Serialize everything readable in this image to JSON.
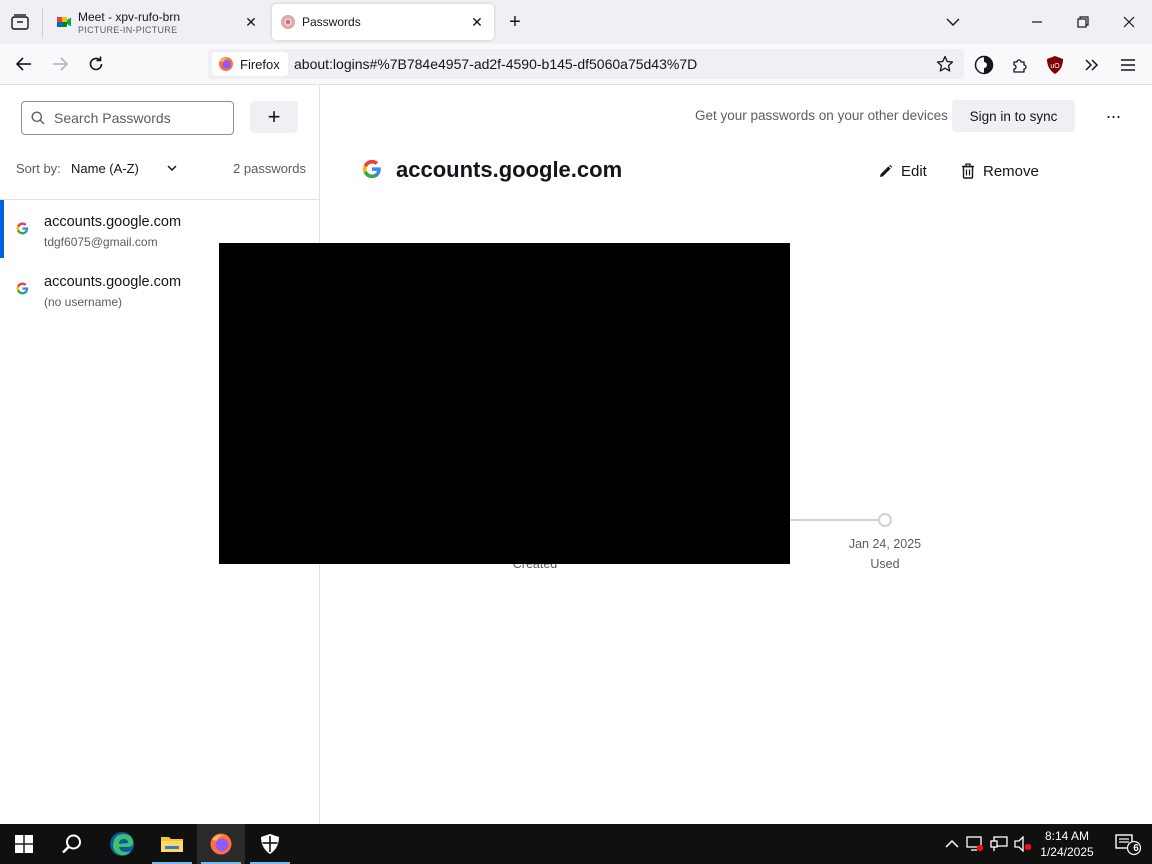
{
  "browser": {
    "tabs": [
      {
        "title": "Meet - xpv-rufo-brn",
        "subtitle": "PICTURE-IN-PICTURE",
        "icon": "google-meet-icon",
        "active": false
      },
      {
        "title": "Passwords",
        "icon": "passwords-icon",
        "active": true
      }
    ],
    "identity_label": "Firefox",
    "url": "about:logins#%7B784e4957-ad2f-4590-b145-df5060a75d43%7D"
  },
  "sidebar": {
    "search_placeholder": "Search Passwords",
    "add_label": "+",
    "sort_label": "Sort by:",
    "sort_value": "Name (A-Z)",
    "count": "2 passwords",
    "items": [
      {
        "host": "accounts.google.com",
        "user": "tdgf6075@gmail.com",
        "selected": true
      },
      {
        "host": "accounts.google.com",
        "user": "(no username)",
        "selected": false
      }
    ]
  },
  "detail": {
    "sync_message": "Get your passwords on your other devices",
    "signin_label": "Sign in to sync",
    "more_label": "···",
    "title": "accounts.google.com",
    "edit_label": "Edit",
    "remove_label": "Remove",
    "timeline": {
      "created_label": "Created",
      "used_date": "Jan 24, 2025",
      "used_label": "Used"
    }
  },
  "taskbar": {
    "time": "8:14 AM",
    "date": "1/24/2025",
    "notification_count": "6"
  },
  "colors": {
    "accent": "#0061e0",
    "tabstrip": "#f0f0f4",
    "taskbar": "#101010",
    "pip_overlay": "#000000"
  }
}
